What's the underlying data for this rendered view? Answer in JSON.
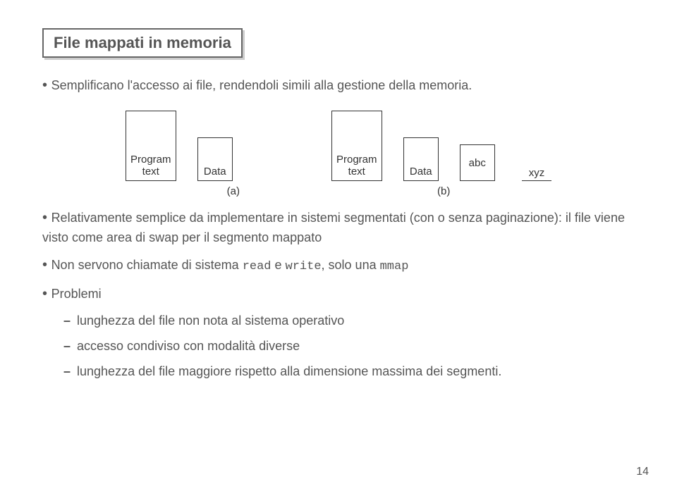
{
  "title": "File mappati in memoria",
  "intro": "Semplificano l'accesso ai file, rendendoli simili alla gestione della memoria.",
  "diagram": {
    "program_text": "Program\ntext",
    "data_label": "Data",
    "abc": "abc",
    "xyz": "xyz",
    "label_a": "(a)",
    "label_b": "(b)"
  },
  "bullets": {
    "b1": "Relativamente semplice da implementare in sistemi segmentati (con o senza paginazione): il file viene visto come area di swap per il segmento mappato",
    "b2_pre": "Non servono chiamate di sistema ",
    "b2_read": "read",
    "b2_mid": " e ",
    "b2_write": "write",
    "b2_post": ", solo una ",
    "b2_mmap": "mmap",
    "b3": "Problemi"
  },
  "subs": {
    "s1": "lunghezza del file non nota al sistema operativo",
    "s2": "accesso condiviso con modalità diverse",
    "s3": "lunghezza del file maggiore rispetto alla dimensione massima dei segmenti."
  },
  "page": "14"
}
